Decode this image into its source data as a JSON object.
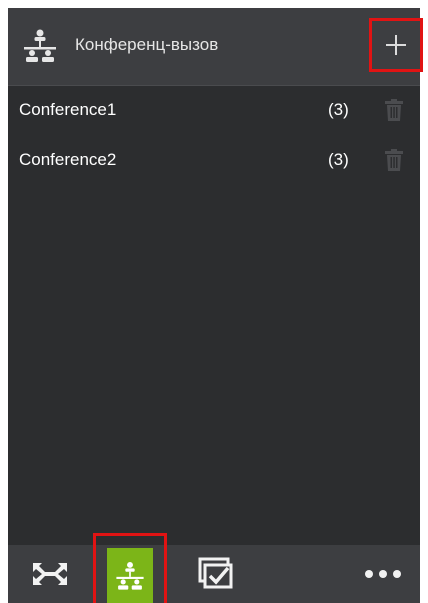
{
  "header": {
    "title": "Конференц-вызов",
    "icon": "conference-icon",
    "add_icon": "plus-icon"
  },
  "conferences": [
    {
      "name": "Conference1",
      "count": "(3)"
    },
    {
      "name": "Conference2",
      "count": "(3)"
    }
  ],
  "bottom_bar": {
    "tabs": [
      {
        "icon": "connect-arrows-icon",
        "active": false
      },
      {
        "icon": "conference-icon",
        "active": true
      },
      {
        "icon": "tasks-check-icon",
        "active": false
      },
      {
        "icon": "more-dots-icon",
        "active": false
      }
    ]
  },
  "colors": {
    "panel": "#2c2d2f",
    "header": "#3d3e41",
    "active_tab": "#7cb518",
    "highlight": "#e11313",
    "text": "#ffffff",
    "trash_icon": "#4b4c4f"
  }
}
